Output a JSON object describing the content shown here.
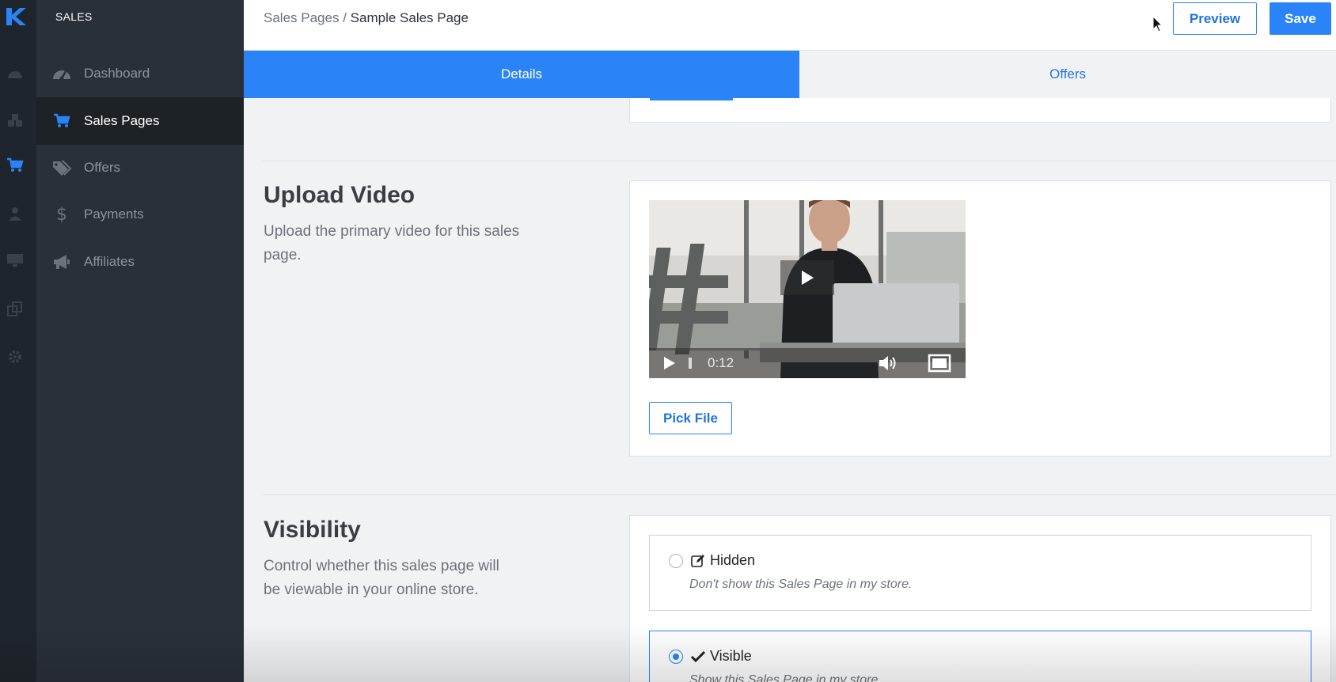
{
  "sidebar": {
    "section_title": "SALES",
    "items": [
      {
        "label": "Dashboard",
        "icon": "dashboard-gauge-icon",
        "active": false
      },
      {
        "label": "Sales Pages",
        "icon": "cart-icon",
        "active": true
      },
      {
        "label": "Offers",
        "icon": "tags-icon",
        "active": false
      },
      {
        "label": "Payments",
        "icon": "dollar-icon",
        "active": false
      },
      {
        "label": "Affiliates",
        "icon": "megaphone-icon",
        "active": false
      }
    ]
  },
  "rail": {
    "icons": [
      "kajabi-logo",
      "dashboard-icon",
      "cubes-icon",
      "cart-icon",
      "user-icon",
      "monitor-icon",
      "copy-icon",
      "gear-icon"
    ]
  },
  "header": {
    "breadcrumb_parent": "Sales Pages",
    "breadcrumb_separator": "/",
    "breadcrumb_current": "Sample Sales Page",
    "preview_label": "Preview",
    "save_label": "Save"
  },
  "tabs": [
    {
      "label": "Details",
      "active": true
    },
    {
      "label": "Offers",
      "active": false
    }
  ],
  "upload_video": {
    "title": "Upload Video",
    "description": "Upload the primary video for this sales page.",
    "video_time": "0:12",
    "pick_file_label": "Pick File"
  },
  "visibility": {
    "title": "Visibility",
    "description": "Control whether this sales page will be viewable in your online store.",
    "options": [
      {
        "label": "Hidden",
        "description": "Don't show this Sales Page in my store.",
        "selected": false
      },
      {
        "label": "Visible",
        "description": "Show this Sales Page in my store.",
        "selected": true
      }
    ]
  },
  "colors": {
    "accent": "#2a84f7",
    "sidebar_bg": "#2a3038",
    "rail_bg": "#1f252c"
  }
}
